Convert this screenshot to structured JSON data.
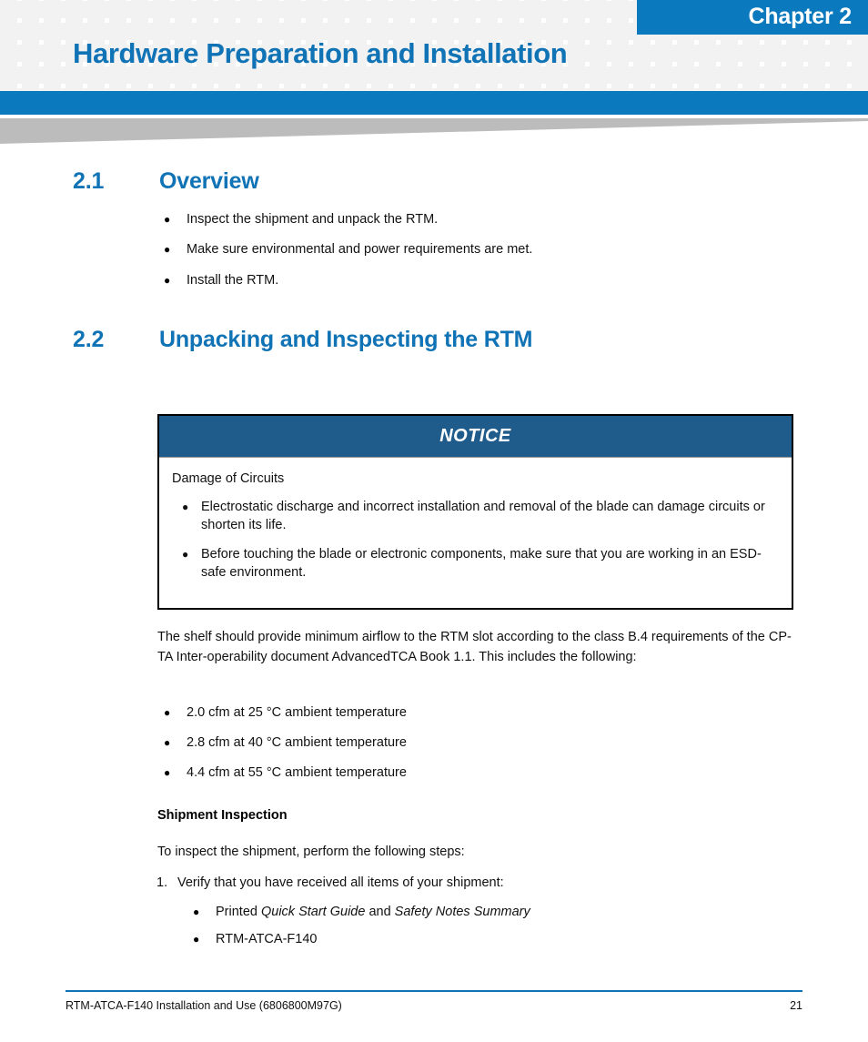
{
  "header": {
    "chapter_label": "Chapter 2",
    "doc_title": "Hardware Preparation and Installation",
    "accent_blue": "#0b79bd",
    "title_blue": "#1073b5",
    "pattern_gray": "#f2f2f2",
    "wedge_gray": "#bcbcbc"
  },
  "sections": [
    {
      "number": "2.1",
      "title": "Overview",
      "bullets": [
        "Inspect the shipment and unpack the RTM.",
        "Make sure environmental and power requirements are met.",
        "Install the RTM."
      ]
    },
    {
      "number": "2.2",
      "title": "Unpacking and Inspecting the RTM"
    }
  ],
  "notice": {
    "heading": "NOTICE",
    "lead": "Damage of Circuits",
    "header_color": "#1f5c8c",
    "bullets": [
      "Electrostatic discharge and incorrect installation and removal of the blade can damage circuits or shorten its life.",
      "Before touching the blade or electronic components, make sure that you are working in an ESD-safe environment."
    ]
  },
  "airflow": {
    "paragraph": "The shelf should provide minimum airflow to the RTM slot according to the class B.4 requirements of the CP-TA Inter-operability document AdvancedTCA Book 1.1. This includes the following:",
    "bullets": [
      "2.0 cfm at 25 °C ambient temperature",
      "2.8 cfm at 40 °C  ambient temperature",
      "4.4 cfm at 55 °C  ambient temperature"
    ]
  },
  "shipment": {
    "subheading": "Shipment Inspection",
    "intro": "To inspect the shipment, perform the following steps:",
    "step_number": "1.",
    "step_text": "Verify that you have received all items of your shipment:",
    "sub_bullets": [
      {
        "prefix": "Printed ",
        "italic1": "Quick Start Guide",
        "middle": " and ",
        "italic2": "Safety Notes Summary"
      },
      {
        "plain": "RTM-ATCA-F140"
      }
    ]
  },
  "footer": {
    "text": "RTM-ATCA-F140 Installation and Use (6806800M97G)",
    "page": "21",
    "rule_color": "#1073b5"
  },
  "glyphs": {
    "bullet": "●"
  }
}
